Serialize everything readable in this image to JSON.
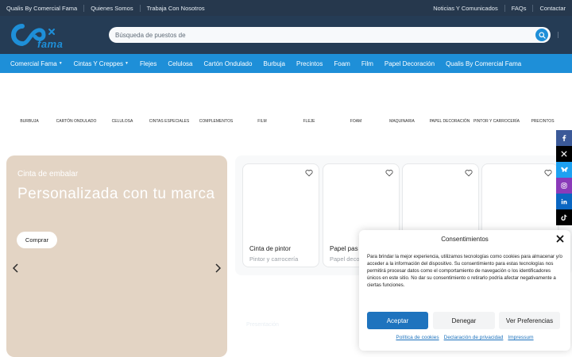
{
  "topbar": {
    "left_links": [
      "Qualis By Comercial Fama",
      "Quienes Somos",
      "Trabaja Con Nosotros"
    ],
    "right_links": [
      "Noticias Y Comunicados",
      "FAQs",
      "Contactar"
    ]
  },
  "header": {
    "logo_text": "fama",
    "search_placeholder": "Búsqueda de puestos de"
  },
  "nav": {
    "items": [
      {
        "label": "Comercial Fama",
        "dropdown": true
      },
      {
        "label": "Cintas Y Creppes",
        "dropdown": true
      },
      {
        "label": "Flejes",
        "dropdown": false
      },
      {
        "label": "Celulosa",
        "dropdown": false
      },
      {
        "label": "Cartón Ondulado",
        "dropdown": false
      },
      {
        "label": "Burbuja",
        "dropdown": false
      },
      {
        "label": "Precintos",
        "dropdown": false
      },
      {
        "label": "Foam",
        "dropdown": false
      },
      {
        "label": "Film",
        "dropdown": false
      },
      {
        "label": "Papel Decoración",
        "dropdown": false
      },
      {
        "label": "Qualis By Comercial Fama",
        "dropdown": false
      }
    ]
  },
  "categories": [
    "BURBUJA",
    "CARTÓN ONDULADO",
    "CELULOSA",
    "CINTAS ESPECIALES",
    "COMPLEMENTOS",
    "FILM",
    "FLEJE",
    "FOAM",
    "MAQUINARIA",
    "PAPEL DECORACIÓN",
    "PINTOR Y CARROCERÍA",
    "PRECINTOS"
  ],
  "hero": {
    "subtitle": "Cinta de embalar",
    "title": "Personalizada con tu marca",
    "button": "Comprar",
    "bg_color": "#e3d4c4"
  },
  "products": [
    {
      "name": "Cinta de pintor",
      "category": "Pintor y carrocería"
    },
    {
      "name": "Papel pas",
      "category": "Papel deco"
    },
    {
      "name": "",
      "category": ""
    },
    {
      "name": "",
      "category": ""
    }
  ],
  "ghost_text": "Presentación",
  "social": [
    "facebook-icon",
    "x-icon",
    "bluesky-icon",
    "instagram-icon",
    "linkedin-icon",
    "tiktok-icon"
  ],
  "consent": {
    "title": "Consentimientos",
    "body": "Para brindar la mejor experiencia, utilizamos tecnologías como cookies para almacenar y/o acceder a la información del dispositivo. Su consentimiento para estas tecnologías nos permitirá procesar datos como el comportamiento de navegación o los identificadores únicos en este sitio. No dar su consentimiento o retirarlo podría afectar negativamente a ciertas funciones.",
    "accept": "Aceptar",
    "deny": "Denegar",
    "preferences": "Ver Preferencias",
    "links": [
      "Política de cookies",
      "Declaración de privacidad",
      "Impressum"
    ]
  },
  "colors": {
    "topbar": "#26384d",
    "header": "#253c55",
    "nav": "#1e8fd8",
    "accent": "#1e73be"
  }
}
